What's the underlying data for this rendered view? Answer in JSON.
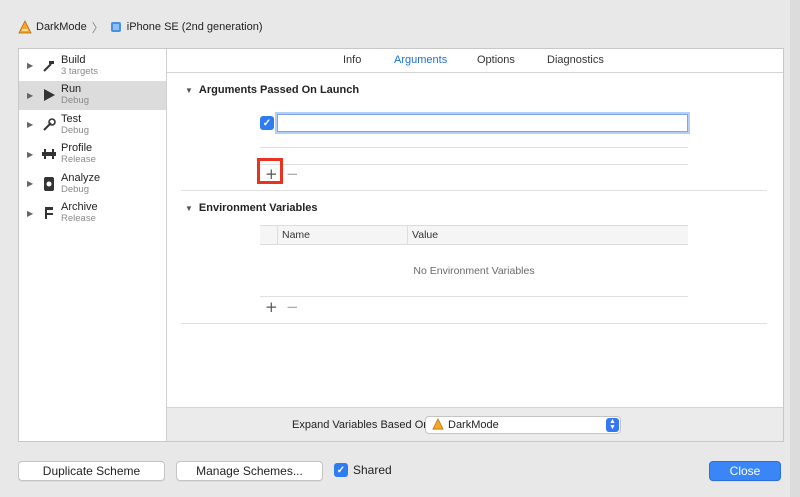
{
  "breadcrumb": {
    "project": "DarkMode",
    "device": "iPhone SE (2nd generation)"
  },
  "sidebar": {
    "items": [
      {
        "name": "Build",
        "sub": "3 targets",
        "icon": "hammer-icon"
      },
      {
        "name": "Run",
        "sub": "Debug",
        "icon": "play-icon"
      },
      {
        "name": "Test",
        "sub": "Debug",
        "icon": "wrench-icon"
      },
      {
        "name": "Profile",
        "sub": "Release",
        "icon": "gauge-icon"
      },
      {
        "name": "Analyze",
        "sub": "Debug",
        "icon": "analyze-icon"
      },
      {
        "name": "Archive",
        "sub": "Release",
        "icon": "archive-icon"
      }
    ],
    "selected": "Run"
  },
  "tabs": [
    "Info",
    "Arguments",
    "Options",
    "Diagnostics"
  ],
  "active_tab": "Arguments",
  "arguments": {
    "title": "Arguments Passed On Launch",
    "value": "",
    "checked": true
  },
  "environment": {
    "title": "Environment Variables",
    "col_name": "Name",
    "col_value": "Value",
    "empty": "No Environment Variables"
  },
  "add_symbol": "+",
  "remove_symbol": "−",
  "expand": {
    "label": "Expand Variables Based On",
    "value": "DarkMode"
  },
  "footer": {
    "duplicate": "Duplicate Scheme",
    "manage": "Manage Schemes...",
    "shared": "Shared",
    "close": "Close"
  },
  "colors": {
    "accent": "#3a86f7",
    "highlight": "#e8341e",
    "tab_active": "#1d6fd8"
  }
}
